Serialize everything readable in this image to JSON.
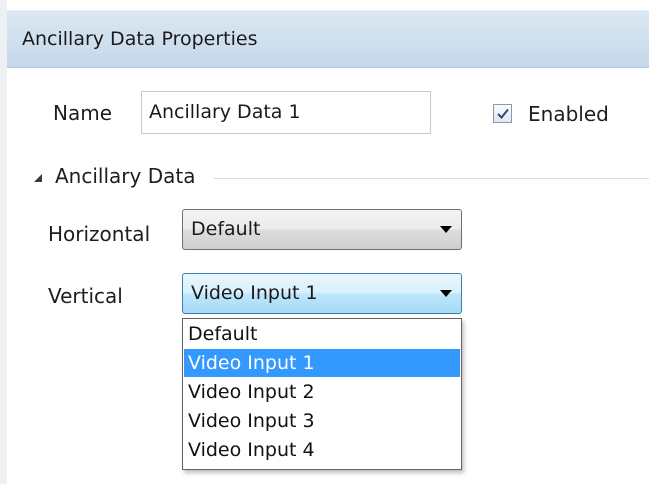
{
  "panel": {
    "title": "Ancillary Data Properties"
  },
  "name_row": {
    "label": "Name",
    "value": "Ancillary Data 1",
    "enabled_label": "Enabled",
    "enabled_checked": true
  },
  "section": {
    "title": "Ancillary Data",
    "expanded": true
  },
  "horizontal": {
    "label": "Horizontal",
    "selected": "Default"
  },
  "vertical": {
    "label": "Vertical",
    "selected": "Video Input 1",
    "options": [
      "Default",
      "Video Input 1",
      "Video Input 2",
      "Video Input 3",
      "Video Input 4"
    ]
  },
  "colors": {
    "selection": "#3399ff",
    "header_bg": "#cfdfee",
    "dropdown_active": "#bee6fd"
  }
}
